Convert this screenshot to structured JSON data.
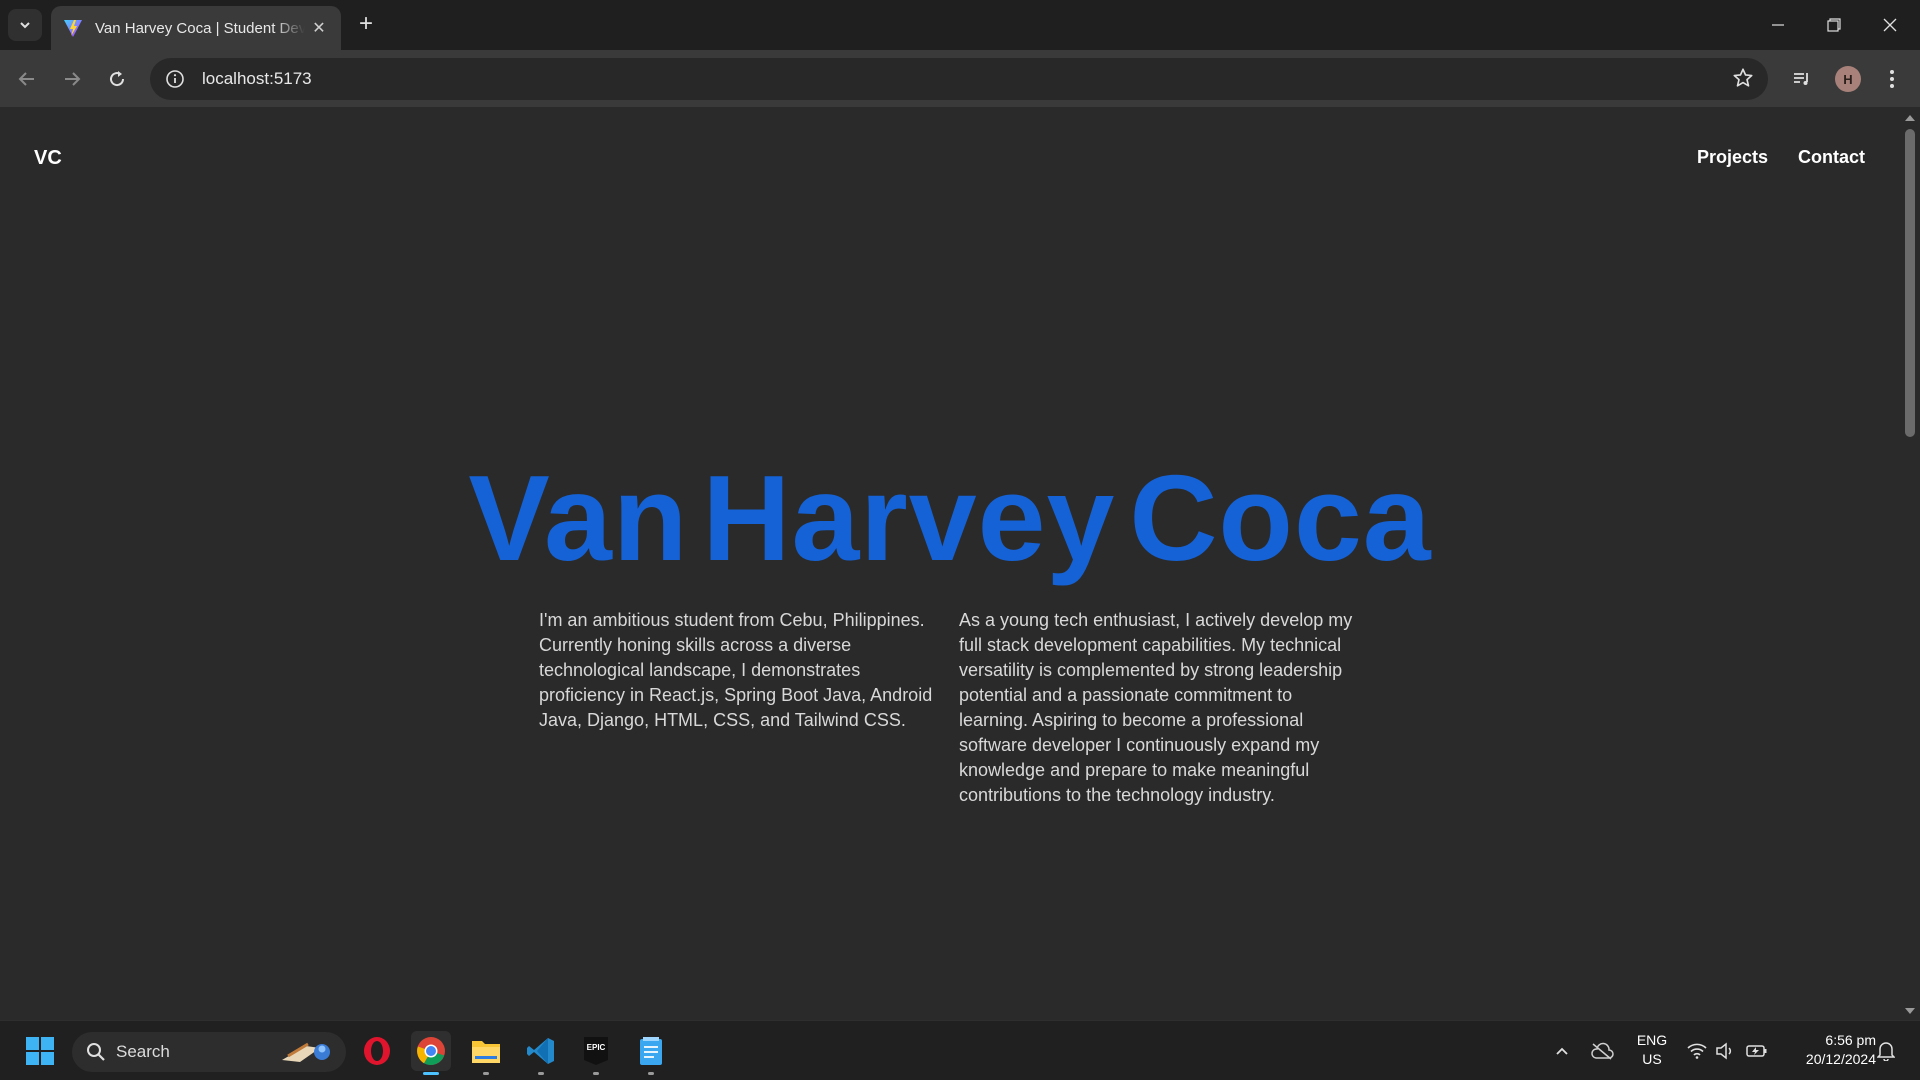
{
  "browser": {
    "tab_title": "Van Harvey Coca | Student Developer",
    "tab_close": "✕",
    "new_tab": "+",
    "url": "localhost:5173",
    "profile_initial": "H"
  },
  "site": {
    "logo": "VC",
    "nav": [
      "Projects",
      "Contact"
    ],
    "hero_name": [
      "Van",
      "Harvey",
      "Coca"
    ],
    "bio_left": "I'm an ambitious student from Cebu, Philippines. Currently honing skills across a diverse technological landscape, I demonstrates proficiency in React.js, Spring Boot Java, Android Java, Django, HTML, CSS, and Tailwind CSS.",
    "bio_right": "As a young tech enthusiast, I actively develop my full stack development capabilities. My technical versatility is complemented by strong leadership potential and a passionate commitment to learning. Aspiring to become a professional software developer I continuously expand my knowledge and prepare to make meaningful contributions to the technology industry.",
    "accent_color": "#1462d6"
  },
  "taskbar": {
    "search_label": "Search",
    "apps": [
      "windows-start-icon",
      "opera-icon",
      "chrome-icon",
      "file-explorer-icon",
      "vscode-icon",
      "epic-games-icon",
      "notepad-icon"
    ],
    "language": "ENG",
    "region": "US",
    "time": "6:56 pm",
    "date": "20/12/2024",
    "epic_label": "EPIC"
  }
}
